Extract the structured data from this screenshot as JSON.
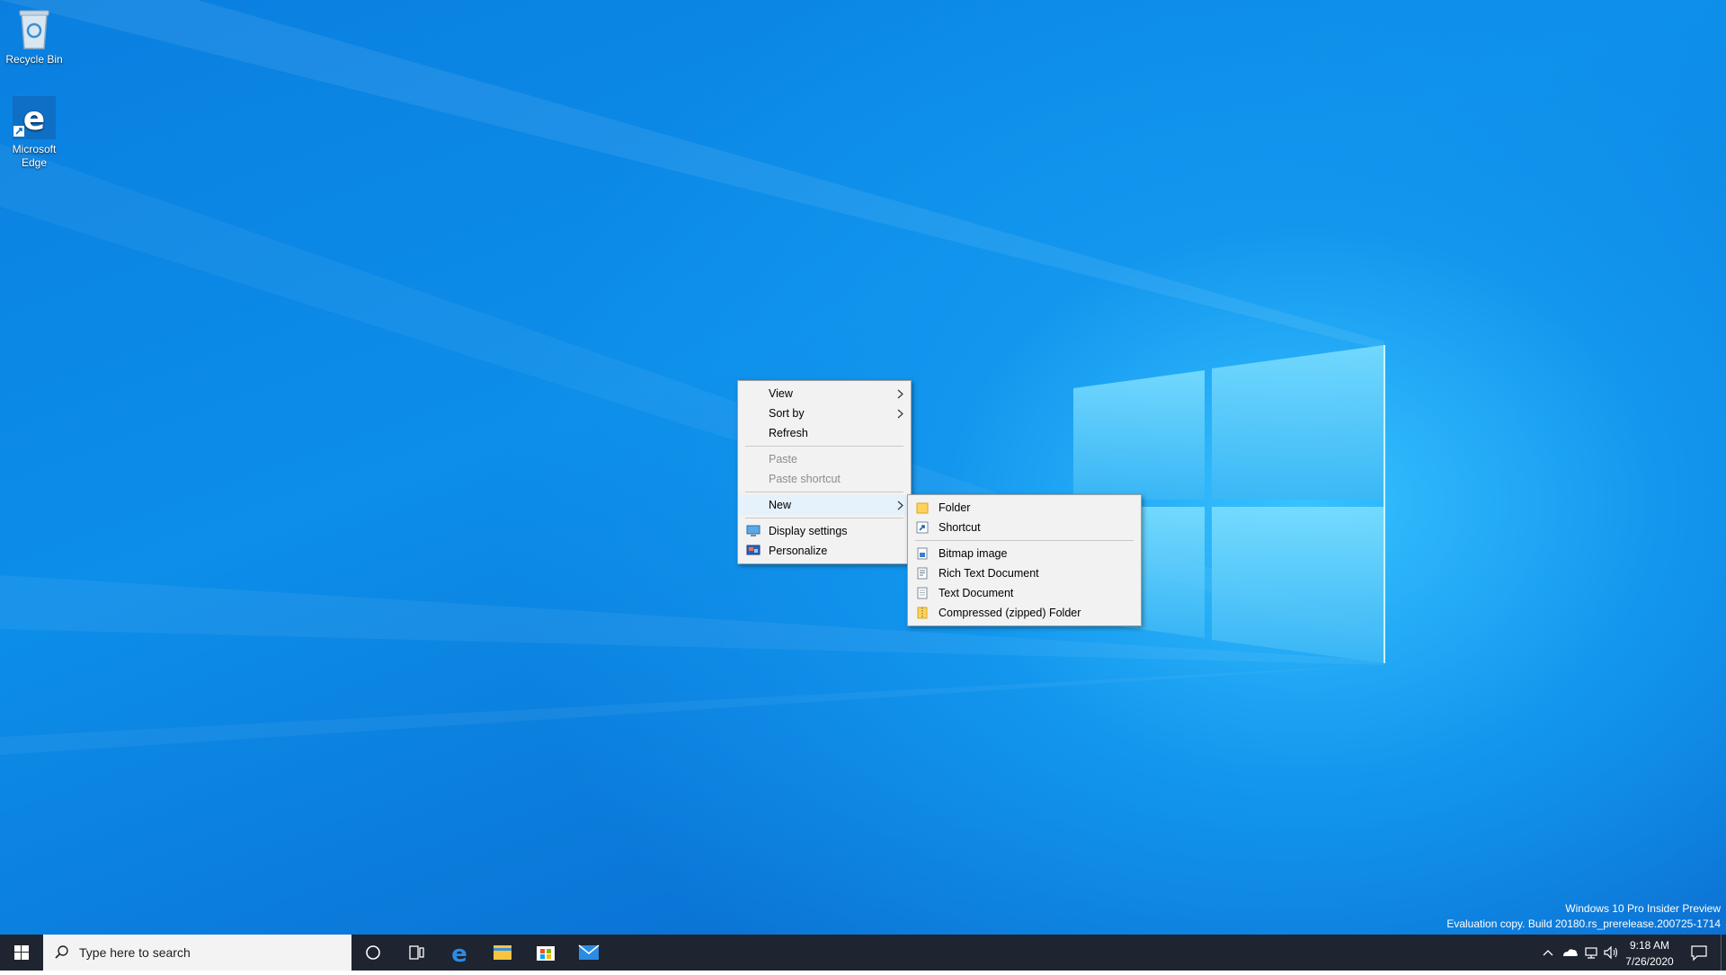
{
  "desktop": {
    "icons": [
      {
        "label": "Recycle Bin"
      },
      {
        "label_line1": "Microsoft",
        "label_line2": "Edge"
      }
    ]
  },
  "context_menu": {
    "items": [
      {
        "label": "View"
      },
      {
        "label": "Sort by"
      },
      {
        "label": "Refresh"
      },
      {
        "label": "Paste"
      },
      {
        "label": "Paste shortcut"
      },
      {
        "label": "New"
      },
      {
        "label": "Display settings"
      },
      {
        "label": "Personalize"
      }
    ]
  },
  "new_submenu": {
    "items": [
      {
        "label": "Folder"
      },
      {
        "label": "Shortcut"
      },
      {
        "label": "Bitmap image"
      },
      {
        "label": "Rich Text Document"
      },
      {
        "label": "Text Document"
      },
      {
        "label": "Compressed (zipped) Folder"
      }
    ]
  },
  "watermark": {
    "line1": "Windows 10 Pro Insider Preview",
    "line2": "Evaluation copy. Build 20180.rs_prerelease.200725-1714"
  },
  "taskbar": {
    "search_placeholder": "Type here to search",
    "clock_time": "9:18 AM",
    "clock_date": "7/26/2020",
    "pinned_icons": [
      "cortana-icon",
      "task-view-icon",
      "edge-icon",
      "file-explorer-icon",
      "store-icon",
      "mail-icon"
    ]
  },
  "colors": {
    "taskbar": "#1e2430",
    "menu_bg": "#f2f2f2",
    "menu_highlight": "#e5f1fb",
    "desktop_blue": "#0a7fe0"
  }
}
